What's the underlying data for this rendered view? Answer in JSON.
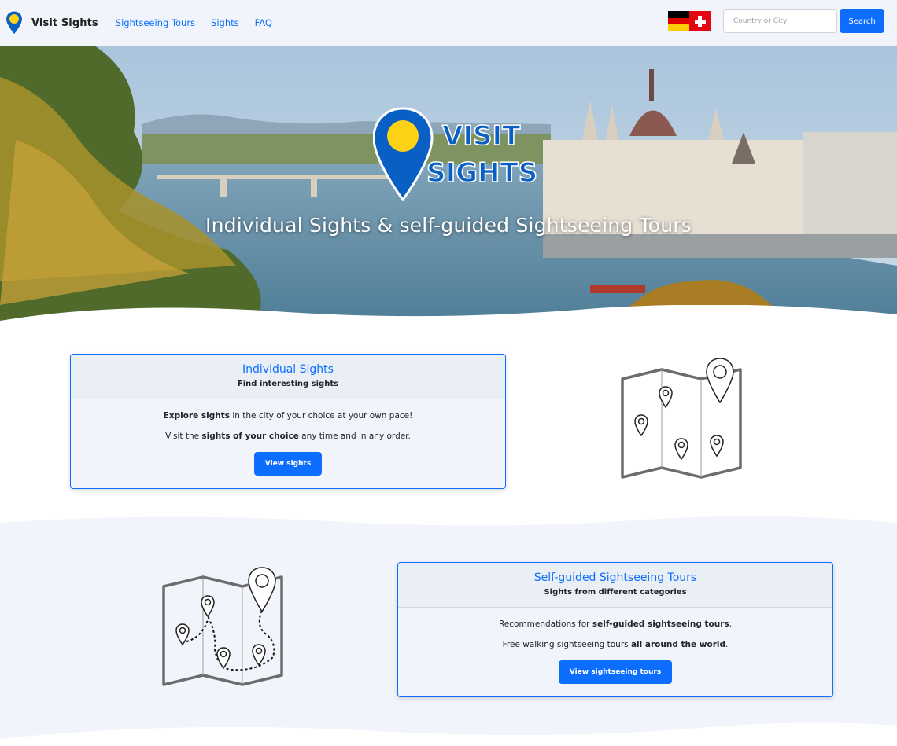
{
  "navbar": {
    "brand_name": "Visit Sights",
    "brand_icon": "map-pin-icon",
    "links": [
      "Sightseeing Tours",
      "Sights",
      "FAQ"
    ],
    "language_flag": "german-flag-icon",
    "search": {
      "placeholder": "Country or City",
      "button_label": "Search"
    }
  },
  "hero": {
    "logo_text_line1": "VISIT",
    "logo_text_line2": "SIGHTS",
    "tagline": "Individual Sights & self-guided Sightseeing Tours"
  },
  "card_sights": {
    "title": "Individual Sights",
    "subtitle": "Find interesting sights",
    "line1_bold": "Explore sights",
    "line1_rest": " in the city of your choice at your own pace!",
    "line2_pre": "Visit the ",
    "line2_bold": "sights of your choice",
    "line2_rest": " any time and in any order.",
    "button_label": "View sights"
  },
  "card_tours": {
    "title": "Self-guided Sightseeing Tours",
    "subtitle": "Sights from different categories",
    "line1_pre": "Recommendations for ",
    "line1_bold": "self-guided sightseeing tours",
    "line1_rest": ".",
    "line2_pre": "Free walking sightseeing tours ",
    "line2_bold": "all around the world",
    "line2_rest": ".",
    "button_label": "View sightseeing tours"
  },
  "colors": {
    "primary": "#0d6efd",
    "navbar_bg": "#f1f5fb",
    "logo_blue": "#0a5fc4",
    "logo_yellow": "#fcd116"
  }
}
